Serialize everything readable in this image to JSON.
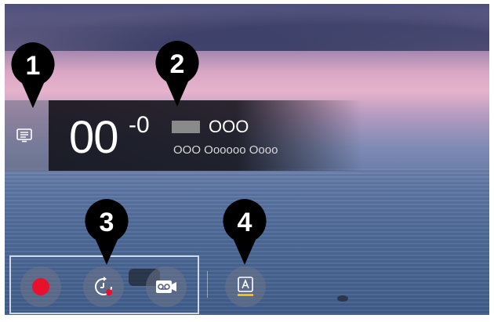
{
  "channel": {
    "number_main": "00",
    "number_sub": "-0",
    "name": "OOO",
    "program": "OOO Oooooo Oooo"
  },
  "controls": {
    "record": "record-icon",
    "timer_record": "timer-record-icon",
    "recordings": "recordings-icon",
    "option": "accessibility-icon"
  },
  "markers": [
    "1",
    "2",
    "3",
    "4"
  ],
  "colors": {
    "record_red": "#e8102a",
    "accent_yellow": "#f2c200",
    "marker_bg": "#000000"
  }
}
